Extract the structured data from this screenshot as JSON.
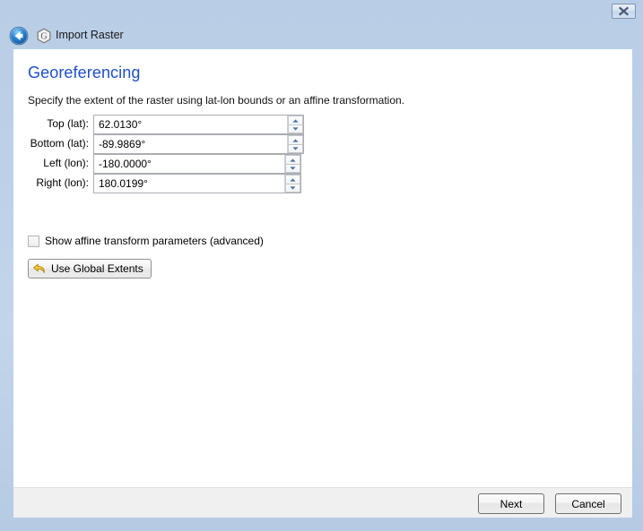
{
  "window": {
    "title": "Import Raster",
    "close_label": "×",
    "back_label": "Back",
    "logo_letter": "G"
  },
  "page": {
    "heading": "Georeferencing",
    "description": "Specify the extent of the raster using lat-lon bounds or an affine transformation."
  },
  "fields": [
    {
      "label": "Top (lat):",
      "value": "62.0130°"
    },
    {
      "label": "Bottom (lat):",
      "value": "-89.9869°"
    },
    {
      "label": "Left (lon):",
      "value": "-180.0000°"
    },
    {
      "label": "Right (lon):",
      "value": "180.0199°"
    }
  ],
  "options": {
    "show_affine_label": "Show affine transform parameters (advanced)",
    "show_affine_checked": false
  },
  "actions": {
    "use_global_extents": "Use Global Extents"
  },
  "footer": {
    "next": "Next",
    "cancel": "Cancel"
  },
  "colors": {
    "heading": "#1e50c8",
    "frame": "#bdd0e8",
    "panel": "#ffffff",
    "footer": "#f0f0f0",
    "spinner_arrow": "#4a6fa5",
    "icon_yellow": "#f2c230"
  }
}
